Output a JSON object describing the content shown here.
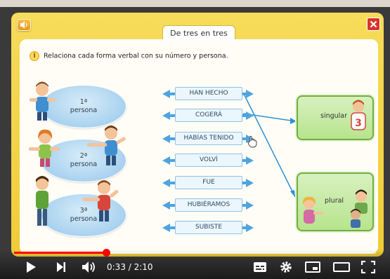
{
  "activity": {
    "tab_title": "De tres en tres",
    "instruction": "Relaciona cada forma verbal con su número y persona.",
    "persons": [
      {
        "label": "1ª\npersona"
      },
      {
        "label": "2ª\npersona"
      },
      {
        "label": "3ª\npersona"
      }
    ],
    "verbs": [
      "HAN HECHO",
      "COGERÁ",
      "HABÍAS TENIDO",
      "VOLVÍ",
      "FUE",
      "HUBIÉRAMOS",
      "SUBISTE"
    ],
    "answers": {
      "singular": "singular",
      "plural": "plural",
      "shirt_number": "3"
    },
    "colors": {
      "frame": "#f2d045",
      "arrow_blue": "#4fa4df",
      "answer_green": "#b7e48e",
      "close_red": "#d8342b"
    }
  },
  "player": {
    "current_time": "0:33",
    "duration": "2:10",
    "time_display": "0:33 / 2:10",
    "progress": 0.254,
    "icons": [
      "play-icon",
      "next-icon",
      "volume-icon",
      "subtitles-icon",
      "settings-icon",
      "miniplayer-icon",
      "theater-icon",
      "fullscreen-icon"
    ]
  }
}
